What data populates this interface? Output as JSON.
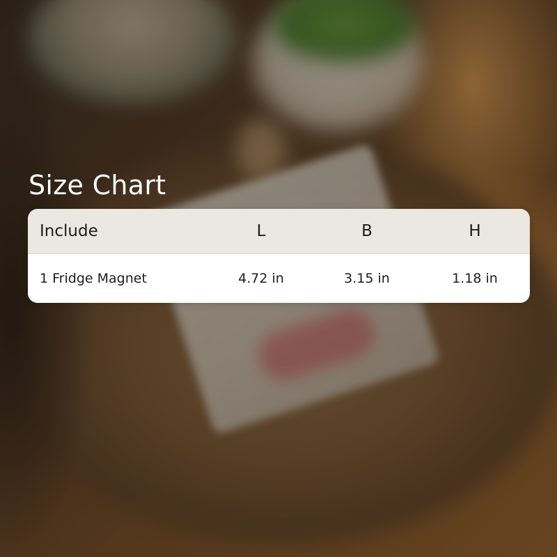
{
  "title": "Size Chart",
  "table": {
    "headers": [
      "Include",
      "L",
      "B",
      "H"
    ],
    "rows": [
      [
        "1 Fridge Magnet",
        "4.72 in",
        "3.15 in",
        "1.18 in"
      ]
    ]
  },
  "colors": {
    "header_bg": "#ebe7e1",
    "body_bg": "#ffffff",
    "title_text": "#ffffff",
    "table_text": "#1d1d1d"
  }
}
